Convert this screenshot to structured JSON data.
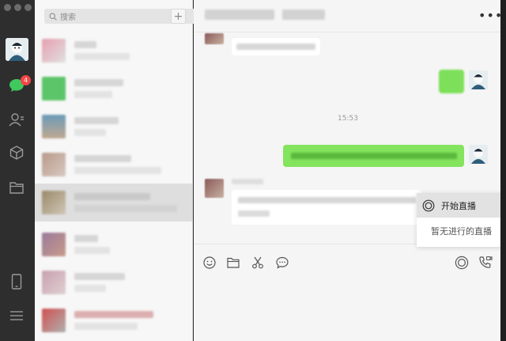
{
  "search": {
    "placeholder": "搜索",
    "add_label": "+"
  },
  "sidebar": {
    "unread_badge": "4"
  },
  "chat": {
    "timestamp": "15:53",
    "more_label": "•••"
  },
  "live_menu": {
    "start_label": "开始直播",
    "empty_label": "暂无进行的直播"
  },
  "colors": {
    "accent_green": "#6cd93f",
    "badge_red": "#f54545"
  }
}
